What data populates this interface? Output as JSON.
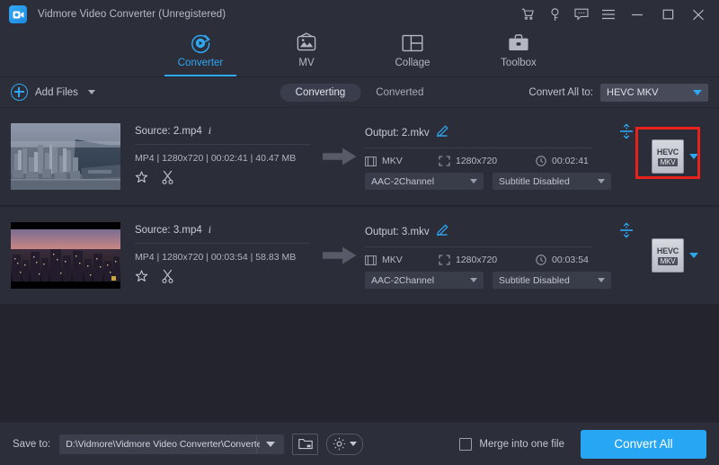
{
  "window": {
    "title": "Vidmore Video Converter (Unregistered)",
    "logo_icon": "video-camera-icon",
    "controls": [
      {
        "name": "cart-icon",
        "glyph": "cart"
      },
      {
        "name": "key-icon",
        "glyph": "key"
      },
      {
        "name": "feedback-icon",
        "glyph": "chat"
      },
      {
        "name": "menu-icon",
        "glyph": "hamburger"
      },
      {
        "name": "minimize-icon",
        "glyph": "minimize"
      },
      {
        "name": "maximize-icon",
        "glyph": "maximize"
      },
      {
        "name": "close-icon",
        "glyph": "close"
      }
    ]
  },
  "nav": {
    "active": "Converter",
    "accent": "#2fa8f2",
    "tabs": [
      {
        "label": "Converter",
        "icon": "converter-icon"
      },
      {
        "label": "MV",
        "icon": "mv-icon"
      },
      {
        "label": "Collage",
        "icon": "collage-icon"
      },
      {
        "label": "Toolbox",
        "icon": "toolbox-icon"
      }
    ]
  },
  "toolbar": {
    "add_files_label": "Add Files",
    "add_files_icon": "plus-circle-icon",
    "segments": [
      {
        "label": "Converting",
        "active": true
      },
      {
        "label": "Converted",
        "active": false
      }
    ],
    "convert_all_to_label": "Convert All to:",
    "convert_all_to_value": "HEVC MKV"
  },
  "rows": [
    {
      "thumbnail": "aerial-city-daytime",
      "source_label": "Source: 2.mp4",
      "info_icon": "info-icon",
      "meta": {
        "container": "MP4",
        "resolution": "1280x720",
        "duration": "00:02:41",
        "size": "40.47 MB",
        "text": "MP4 | 1280x720 | 00:02:41 | 40.47 MB"
      },
      "tools": [
        {
          "name": "edit-icon",
          "title": "Edit"
        },
        {
          "name": "cut-icon",
          "title": "Cut"
        }
      ],
      "arrow_icon": "arrow-right-icon",
      "output_label": "Output: 2.mkv",
      "edit_pencil_icon": "pencil-icon",
      "split_icon": "split-icon",
      "out_format": "MKV",
      "out_resolution": "1280x720",
      "out_duration": "00:02:41",
      "audio_select": "AAC-2Channel",
      "subtitle_select": "Subtitle Disabled",
      "format_badge_top": "HEVC",
      "format_badge_bottom": "MKV",
      "highlighted": true
    },
    {
      "thumbnail": "city-skyline-sunset",
      "source_label": "Source: 3.mp4",
      "info_icon": "info-icon",
      "meta": {
        "container": "MP4",
        "resolution": "1280x720",
        "duration": "00:03:54",
        "size": "58.83 MB",
        "text": "MP4 | 1280x720 | 00:03:54 | 58.83 MB"
      },
      "tools": [
        {
          "name": "edit-icon",
          "title": "Edit"
        },
        {
          "name": "cut-icon",
          "title": "Cut"
        }
      ],
      "arrow_icon": "arrow-right-icon",
      "output_label": "Output: 3.mkv",
      "edit_pencil_icon": "pencil-icon",
      "split_icon": "split-icon",
      "out_format": "MKV",
      "out_resolution": "1280x720",
      "out_duration": "00:03:54",
      "audio_select": "AAC-2Channel",
      "subtitle_select": "Subtitle Disabled",
      "format_badge_top": "HEVC",
      "format_badge_bottom": "MKV",
      "highlighted": false
    }
  ],
  "footer": {
    "save_to_label": "Save to:",
    "save_to_path": "D:\\Vidmore\\Vidmore Video Converter\\Converted",
    "folder_icon": "folder-icon",
    "settings_icon": "gear-icon",
    "merge_label": "Merge into one file",
    "merge_checked": false,
    "convert_all_label": "Convert All",
    "convert_all_color": "#27a6f3"
  },
  "annotation": {
    "highlight_color": "#e8211b",
    "target": "row-1-format-button"
  }
}
